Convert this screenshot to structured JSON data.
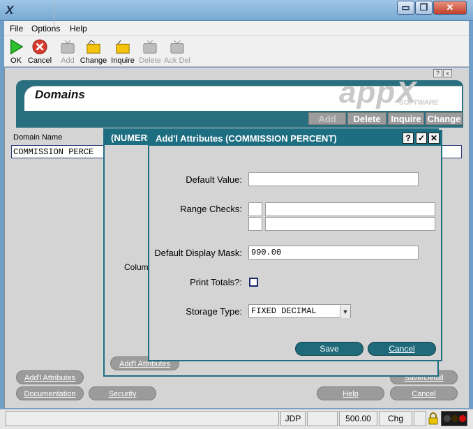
{
  "window": {
    "minimize_glyph": "▭",
    "restore_glyph": "❐",
    "close_glyph": "✕"
  },
  "menu": [
    "File",
    "Options",
    "Help"
  ],
  "toolbar": [
    {
      "label": "OK",
      "icon": "ok-play-icon",
      "enabled": true
    },
    {
      "label": "Cancel",
      "icon": "cancel-x-icon",
      "enabled": true
    },
    {
      "label": "Add",
      "icon": "add-tv-icon",
      "enabled": false
    },
    {
      "label": "Change",
      "icon": "change-folder-icon",
      "enabled": true
    },
    {
      "label": "Inquire",
      "icon": "inquire-folder-icon",
      "enabled": true
    },
    {
      "label": "Delete",
      "icon": "delete-tv-icon",
      "enabled": false
    },
    {
      "label": "Ack Del",
      "icon": "ack-delete-tv-icon",
      "enabled": false
    }
  ],
  "panel": {
    "title": "Domains",
    "logo_text": "appX",
    "logo_sub": "SOFTWARE",
    "mini_help": "?",
    "mini_close": "x",
    "header_buttons": [
      "Add",
      "Delete",
      "Inquire",
      "Change"
    ],
    "column_header": "Domain Name",
    "selected_row": "COMMISSION PERCE"
  },
  "bottom_buttons": {
    "addl_attributes": "Add'l Attributes",
    "documentation": "Documentation",
    "security": "Security",
    "save_detail": "Save/Detail",
    "help": "Help",
    "cancel": "Cancel"
  },
  "numeric_dialog": {
    "title": "(NUMERI",
    "colum_label": "Colum",
    "addl_button": "Add'l Attributes"
  },
  "attr_dialog": {
    "title": "Add'l Attributes (COMMISSION PERCENT)",
    "title_buttons": [
      "?",
      "✓",
      "✕"
    ],
    "default_value_label": "Default Value:",
    "default_value": "",
    "range_checks_label": "Range Checks:",
    "range_checks": [
      {
        "op": "",
        "value": ""
      },
      {
        "op": "",
        "value": ""
      }
    ],
    "display_mask_label": "Default Display Mask:",
    "display_mask": "990.00",
    "print_totals_label": "Print Totals?:",
    "print_totals": false,
    "storage_type_label": "Storage Type:",
    "storage_type": "FIXED DECIMAL",
    "save": "Save",
    "cancel": "Cancel"
  },
  "status_bar": [
    "JDP",
    "500.00",
    "Chg"
  ],
  "colors": {
    "teal": "#1e6e82",
    "panel": "#d4d4d4",
    "accent_green": "#2ec12e",
    "accent_red": "#d63a2a"
  }
}
